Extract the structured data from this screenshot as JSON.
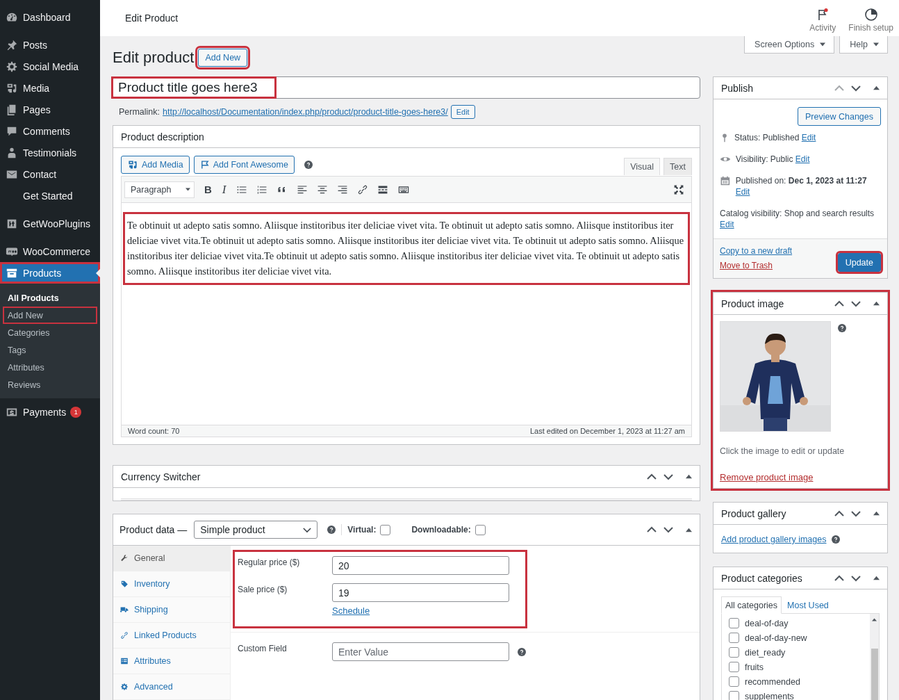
{
  "sidebar": {
    "groups": [
      {
        "items": [
          {
            "label": "Dashboard",
            "selected": false,
            "highlighted": false
          }
        ]
      },
      {
        "items": [
          {
            "label": "Posts",
            "selected": false,
            "highlighted": false
          },
          {
            "label": "Social Media",
            "selected": false,
            "highlighted": false
          },
          {
            "label": "Media",
            "selected": false,
            "highlighted": false
          },
          {
            "label": "Pages",
            "selected": false,
            "highlighted": false
          },
          {
            "label": "Comments",
            "selected": false,
            "highlighted": false
          },
          {
            "label": "Testimonials",
            "selected": false,
            "highlighted": false
          },
          {
            "label": "Contact",
            "selected": false,
            "highlighted": false
          },
          {
            "label": "Get Started",
            "selected": false,
            "highlighted": false
          }
        ]
      },
      {
        "items": [
          {
            "label": "GetWooPlugins",
            "selected": false,
            "highlighted": false
          }
        ]
      },
      {
        "items": [
          {
            "label": "WooCommerce",
            "selected": false,
            "highlighted": false
          },
          {
            "label": "Products",
            "selected": true,
            "highlighted": true,
            "submenu": [
              {
                "label": "All Products",
                "selected": true,
                "highlighted": false
              },
              {
                "label": "Add New",
                "selected": false,
                "highlighted": true
              },
              {
                "label": "Categories",
                "selected": false,
                "highlighted": false
              },
              {
                "label": "Tags",
                "selected": false,
                "highlighted": false
              },
              {
                "label": "Attributes",
                "selected": false,
                "highlighted": false
              },
              {
                "label": "Reviews",
                "selected": false,
                "highlighted": false
              }
            ]
          },
          {
            "label": "Payments",
            "selected": false,
            "highlighted": false,
            "badge": "1"
          }
        ]
      }
    ]
  },
  "topbar": {
    "title": "Edit Product",
    "actions": [
      {
        "label": "Activity",
        "notification": true
      },
      {
        "label": "Finish setup",
        "notification": false
      }
    ]
  },
  "screen_tabs": [
    "Screen Options",
    "Help"
  ],
  "heading": {
    "title": "Edit product",
    "add_new": {
      "label": "Add New",
      "highlighted": true
    }
  },
  "product_title": {
    "value": "Product title goes here3",
    "highlighted": true
  },
  "permalink": {
    "label": "Permalink:",
    "url": "http://localhost/Documentation/index.php/product/product-title-goes-here3/",
    "edit_button": "Edit"
  },
  "description": {
    "title": "Product description",
    "media_buttons": [
      "Add Media",
      "Add Font Awesome"
    ],
    "tabs": [
      {
        "label": "Visual",
        "selected": true
      },
      {
        "label": "Text",
        "selected": false
      }
    ],
    "format_select": "Paragraph",
    "format_buttons": [
      "B",
      "I"
    ],
    "highlighted": true,
    "content": "Te obtinuit ut adepto satis somno. Aliisque institoribus iter deliciae vivet vita. Te obtinuit ut adepto satis somno. Aliisque institoribus iter deliciae vivet vita.Te obtinuit ut adepto satis somno. Aliisque institoribus iter deliciae vivet vita. Te obtinuit ut adepto satis somno. Aliisque institoribus iter deliciae vivet vita.Te obtinuit ut adepto satis somno. Aliisque institoribus iter deliciae vivet vita. Te obtinuit ut adepto satis somno. Aliisque institoribus iter deliciae vivet vita.",
    "word_count": "Word count: 70",
    "last_edited": "Last edited on December 1, 2023 at 11:27 am"
  },
  "currency_switcher": {
    "title": "Currency Switcher"
  },
  "product_data": {
    "title": "Product data —",
    "type": "Simple product",
    "virtual": {
      "label": "Virtual:",
      "checked": false
    },
    "downloadable": {
      "label": "Downloadable:",
      "checked": false
    },
    "tabs": [
      {
        "label": "General",
        "selected": true
      },
      {
        "label": "Inventory",
        "selected": false
      },
      {
        "label": "Shipping",
        "selected": false
      },
      {
        "label": "Linked Products",
        "selected": false
      },
      {
        "label": "Attributes",
        "selected": false
      },
      {
        "label": "Advanced",
        "selected": false
      }
    ],
    "price_fields": {
      "highlighted": true,
      "fields": [
        {
          "label": "Regular price ($)",
          "value": "20"
        },
        {
          "label": "Sale price ($)",
          "value": "19",
          "link": "Schedule"
        }
      ]
    },
    "custom_field": {
      "label": "Custom Field",
      "placeholder": "Enter Value"
    }
  },
  "publish": {
    "title": "Publish",
    "preview_button": "Preview Changes",
    "rows": [
      {
        "text": "Status: Published",
        "link": "Edit"
      },
      {
        "text": "Visibility: Public",
        "link": "Edit"
      },
      {
        "text": "Published on: **Dec 1, 2023 at 11:27**",
        "link": "Edit"
      },
      {
        "text": "Catalog visibility: Shop and search results",
        "link": "Edit"
      }
    ],
    "copy_link": "Copy to a new draft",
    "trash_link": "Move to Trash",
    "update_button": {
      "label": "Update",
      "highlighted": true
    }
  },
  "product_image": {
    "title": "Product image",
    "highlighted": true,
    "caption": "Click the image to edit or update",
    "remove_link": "Remove product image"
  },
  "product_gallery": {
    "title": "Product gallery",
    "link": "Add product gallery images"
  },
  "product_categories": {
    "title": "Product categories",
    "tabs": [
      {
        "label": "All categories",
        "selected": true
      },
      {
        "label": "Most Used",
        "selected": false
      }
    ],
    "items": [
      {
        "label": "deal-of-day",
        "checked": false
      },
      {
        "label": "deal-of-day-new",
        "checked": false
      },
      {
        "label": "diet_ready",
        "checked": false
      },
      {
        "label": "fruits",
        "checked": false
      },
      {
        "label": "recommended",
        "checked": false
      },
      {
        "label": "supplements",
        "checked": false
      }
    ]
  }
}
